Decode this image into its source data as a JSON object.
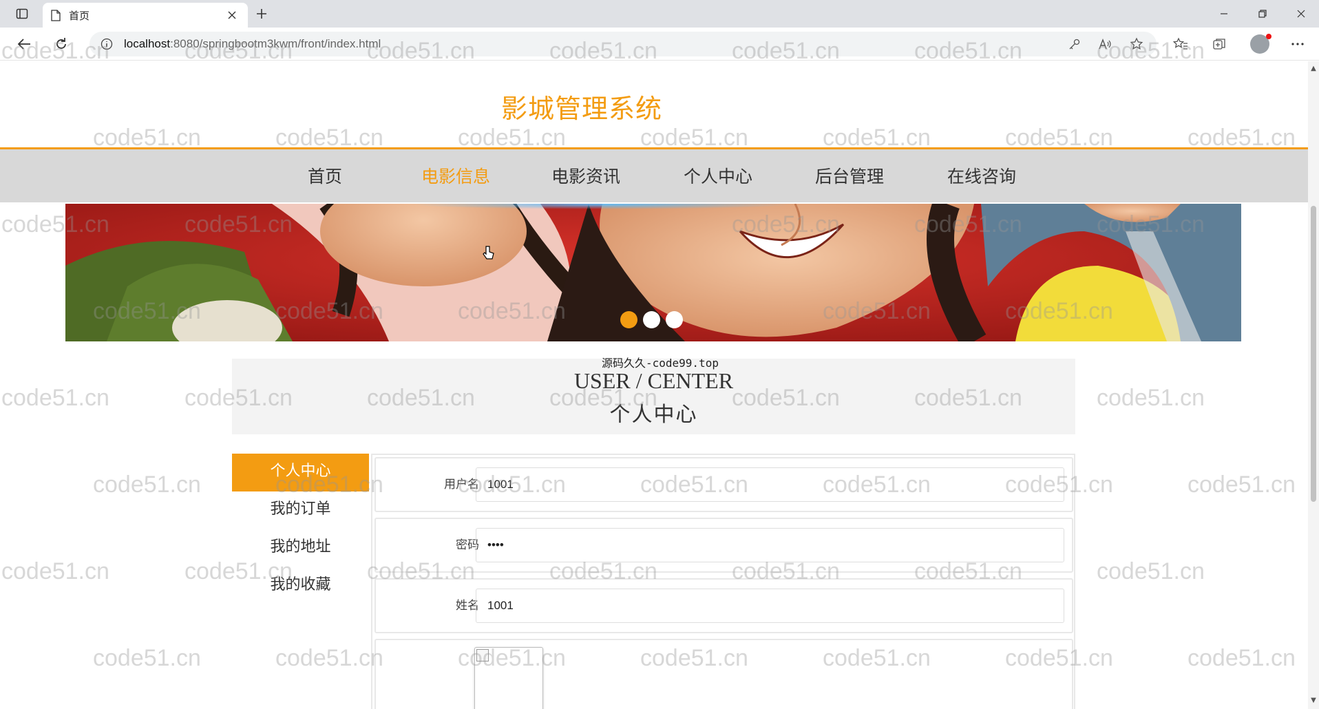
{
  "browser": {
    "tab_title": "首页",
    "url_host": "localhost",
    "url_rest": ":8080/springbootm3kwm/front/index.html"
  },
  "site": {
    "title": "影城管理系统"
  },
  "nav": {
    "items": [
      {
        "label": "首页",
        "active": false
      },
      {
        "label": "电影信息",
        "active": true
      },
      {
        "label": "电影资讯",
        "active": false
      },
      {
        "label": "个人中心",
        "active": false
      },
      {
        "label": "后台管理",
        "active": false
      },
      {
        "label": "在线咨询",
        "active": false
      }
    ]
  },
  "banner": {
    "slide_count": 3,
    "active_slide": 1
  },
  "source_note": "源码久久-code99.top",
  "center": {
    "title_en": "USER / CENTER",
    "title_zh": "个人中心"
  },
  "side_menu": {
    "items": [
      {
        "label": "个人中心",
        "active": true
      },
      {
        "label": "我的订单",
        "active": false
      },
      {
        "label": "我的地址",
        "active": false
      },
      {
        "label": "我的收藏",
        "active": false
      }
    ]
  },
  "form": {
    "username_label": "用户名",
    "username_value": "1001",
    "password_label": "密码",
    "password_value": "••••",
    "name_label": "姓名",
    "name_value": "1001"
  },
  "watermark_text": "code51.cn",
  "colors": {
    "accent": "#f39c12",
    "nav_bg": "#d8d8d8"
  }
}
